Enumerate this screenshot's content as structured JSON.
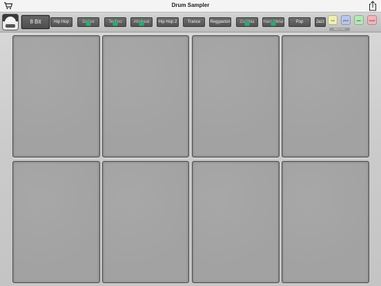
{
  "nav": {
    "title": "Drum Sampler",
    "cart_icon": "cart-icon",
    "share_icon": "share-icon"
  },
  "toolbar": {
    "logo_icon": "drum-machine-icon",
    "kits": [
      {
        "label": "8 Bit",
        "locked": false,
        "selected": true
      },
      {
        "label": "Hip Hop",
        "locked": false,
        "selected": false
      },
      {
        "label": "Dance",
        "locked": true,
        "selected": false
      },
      {
        "label": "Techno",
        "locked": true,
        "selected": false
      },
      {
        "label": "Afrobeat",
        "locked": true,
        "selected": false
      },
      {
        "label": "Hip Hop 2",
        "locked": false,
        "selected": false
      },
      {
        "label": "Trance",
        "locked": false,
        "selected": false
      },
      {
        "label": "Reggaeton",
        "locked": false,
        "selected": false
      },
      {
        "label": "Cumbia",
        "locked": true,
        "selected": false
      },
      {
        "label": "Hard Metal",
        "locked": true,
        "selected": false
      },
      {
        "label": "Pop",
        "locked": false,
        "selected": false
      },
      {
        "label": "Jazz",
        "locked": false,
        "selected": false
      }
    ],
    "fx_buttons": [
      {
        "label": "vol",
        "color": "#efefb4"
      },
      {
        "label": "pitch",
        "color": "#b9c7ef"
      },
      {
        "label": "pan",
        "color": "#b6e8b8"
      },
      {
        "label": "reset",
        "color": "#f2b5bb"
      }
    ],
    "fx_caption": "BEAT STEP"
  },
  "pads": {
    "count": 8,
    "items": [
      {
        "id": "pad-1"
      },
      {
        "id": "pad-2"
      },
      {
        "id": "pad-3"
      },
      {
        "id": "pad-4"
      },
      {
        "id": "pad-5"
      },
      {
        "id": "pad-6"
      },
      {
        "id": "pad-7"
      },
      {
        "id": "pad-8"
      }
    ]
  }
}
